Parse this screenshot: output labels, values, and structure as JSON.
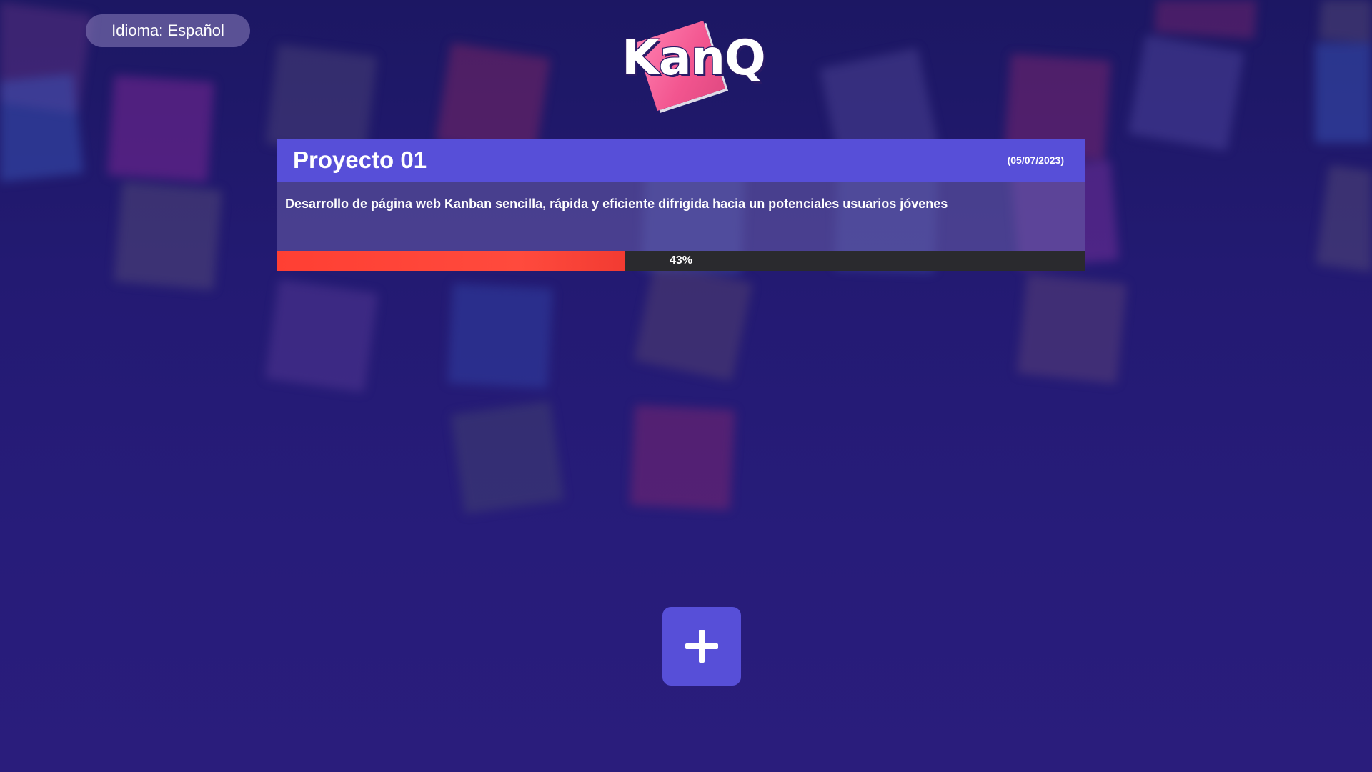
{
  "language": {
    "label": "Idioma: Español"
  },
  "logo": {
    "text": "KanQ"
  },
  "project": {
    "title": "Proyecto 01",
    "date": "(05/07/2023)",
    "description": "Desarrollo de página web Kanban sencilla, rápida y eficiente difrigida hacia un potenciales usuarios jóvenes",
    "progress": 43,
    "progress_label": "43%"
  },
  "colors": {
    "accent": "#574fd8",
    "progress": "#ff4438",
    "track": "#2a2a2e",
    "logo_pink": "#f2558f",
    "background": "#231a72"
  },
  "icons": {
    "add": "plus-icon"
  }
}
